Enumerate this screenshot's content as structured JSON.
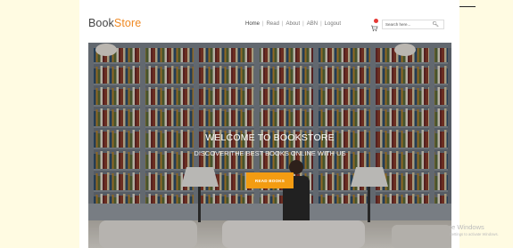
{
  "brand": {
    "part1": "Book",
    "part2": "Store"
  },
  "nav": {
    "items": [
      "Home",
      "Read",
      "About",
      "ABN",
      "Logout"
    ],
    "separator": "|"
  },
  "cart": {
    "icon": "cart-icon"
  },
  "search": {
    "placeholder": "Search here...",
    "icon": "search-icon"
  },
  "hero": {
    "title": "WELCOME TO BOOKSTORE",
    "subtitle": "DISCOVER THE BEST BOOKS ONLINE WITH US",
    "button_label": "READ BOOKS"
  },
  "watermark": {
    "line1": "te Windows",
    "line2": "Settings to activate Windows."
  },
  "colors": {
    "accent": "#f08a24",
    "button": "#f39c12",
    "page_bg": "#fffbe2",
    "badge": "#e53935"
  }
}
